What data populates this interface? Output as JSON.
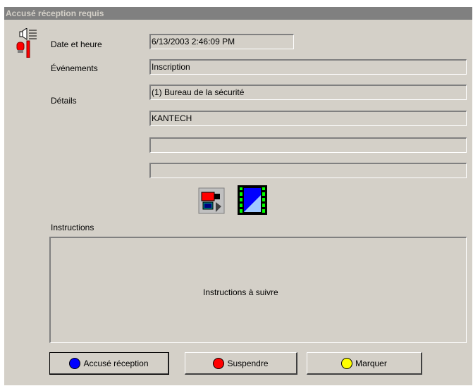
{
  "window": {
    "title": "Accusé réception requis"
  },
  "fields": {
    "date_label": "Date et heure",
    "date_value": "6/13/2003 2:46:09 PM",
    "events_label": "Événements",
    "events_value": "Inscription",
    "details_label": "Détails",
    "details_line1": "(1) Bureau de la sécurité",
    "details_line2": "KANTECH",
    "details_line3": "",
    "details_line4": ""
  },
  "instructions": {
    "label": "Instructions",
    "text": "Instructions à suivre"
  },
  "buttons": {
    "acknowledge": "Accusé réception",
    "suspend": "Suspendre",
    "mark": "Marquer"
  },
  "icons": {
    "alarm": "alarm-siren-icon",
    "camera": "video-camera-icon",
    "video": "video-film-icon"
  },
  "colors": {
    "acknowledge_dot": "#0000ff",
    "suspend_dot": "#ff0000",
    "mark_dot": "#ffff00"
  }
}
